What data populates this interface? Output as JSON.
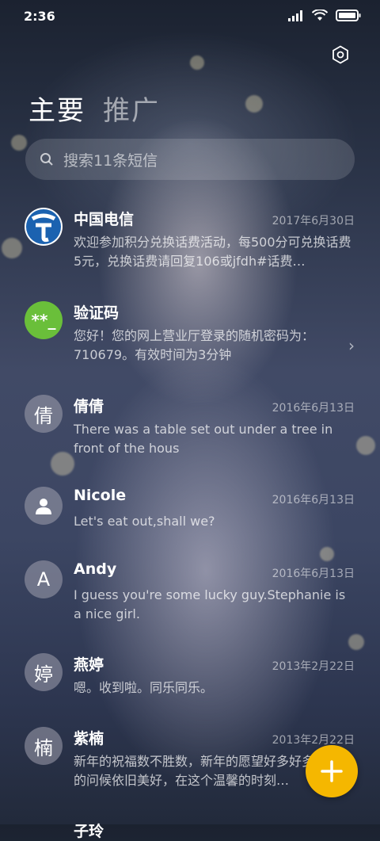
{
  "status_bar": {
    "time": "2:36"
  },
  "tabs": [
    {
      "label": "主要"
    },
    {
      "label": "推广"
    }
  ],
  "search": {
    "placeholder": "搜索11条短信"
  },
  "conversations": [
    {
      "name": "中国电信",
      "date": "2017年6月30日",
      "message": "欢迎参加积分兑换话费活动，每500分可兑换话费5元，兑换话费请回复106或jfdh#话费…",
      "avatar": "telecom-logo"
    },
    {
      "name": "验证码",
      "date": "",
      "message": "您好！您的网上营业厅登录的随机密码为：710679。有效时间为3分钟",
      "avatar_text": "**_"
    },
    {
      "name": "倩倩",
      "date": "2016年6月13日",
      "message": "There was a table set out under a tree in front of the hous",
      "avatar_text": "倩"
    },
    {
      "name": "Nicole",
      "date": "2016年6月13日",
      "message": "Let's eat out,shall we?",
      "avatar": "person-icon"
    },
    {
      "name": "Andy",
      "date": "2016年6月13日",
      "message": "I guess you're some lucky guy.Stephanie is a nice girl.",
      "avatar_text": "A"
    },
    {
      "name": "燕婷",
      "date": "2013年2月22日",
      "message": "嗯。收到啦。同乐同乐。",
      "avatar_text": "婷"
    },
    {
      "name": "紫楠",
      "date": "2013年2月22日",
      "message": "新年的祝福数不胜数，新年的愿望好多好多，新年的问候依旧美好，在这个温馨的时刻…",
      "avatar_text": "楠"
    },
    {
      "name": "子玲",
      "date": "",
      "message": ""
    }
  ],
  "colors": {
    "fab": "#f5b700",
    "code_avatar": "#6abf3a",
    "telecom_blue": "#1b62b0"
  },
  "fab": {
    "icon": "plus-icon"
  }
}
